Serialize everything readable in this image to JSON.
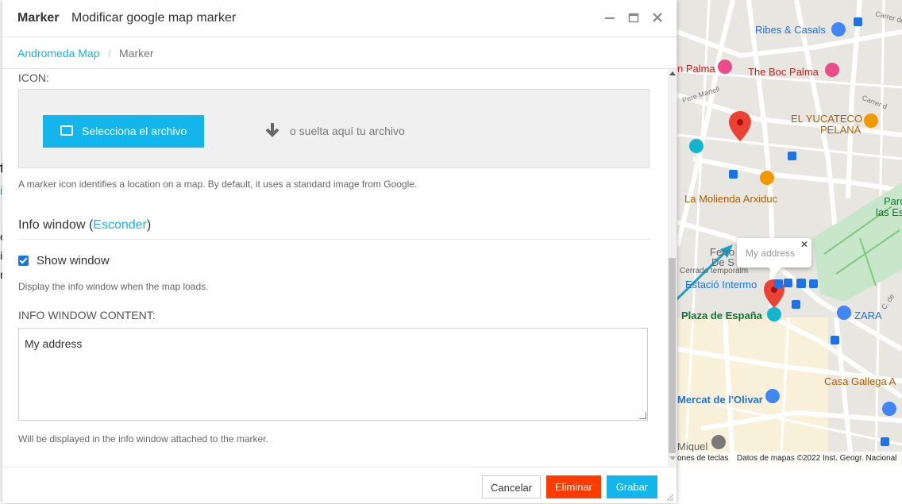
{
  "dialog": {
    "title": "Marker",
    "subtitle": "Modificar google map marker",
    "breadcrumb": {
      "home": "Andromeda Map",
      "separator": "/",
      "current": "Marker"
    },
    "icon_section": {
      "label": "ICON:",
      "select_button": "Selecciona el archivo",
      "drop_text": "o suelta aquí tu archivo",
      "help": "A marker icon identifies a location on a map. By default, it uses a standard image from Google."
    },
    "info_window": {
      "heading": "Info window",
      "toggle_link": "Esconder",
      "show_label": "Show window",
      "show_checked": true,
      "show_help": "Display the info window when the map loads.",
      "content_label": "INFO WINDOW CONTENT:",
      "content_value": "My address",
      "content_help": "Will be displayed in the info window attached to the marker."
    },
    "footer": {
      "cancel": "Cancelar",
      "delete": "Eliminar",
      "save": "Grabar"
    }
  },
  "map": {
    "places": [
      "Ribes & Casals",
      "n Palma",
      "The Boc Palma",
      "EL YUCATECO",
      "PELANÁ",
      "La Molienda Arxiduc",
      "Parc",
      "las Es",
      "Ferro",
      "De S",
      "Cerrado temporalm",
      "Estació Intermo",
      "Plaza de España",
      "ZARA",
      "Casa Gallega A",
      "Mercat de l'Olivar",
      "Miquel"
    ],
    "streets": [
      "Carrer de",
      "Pere Martell",
      "Carrer d",
      "C. de"
    ],
    "info_bubble": "My address",
    "attribution_left": "ones de teclas",
    "attribution_right": "Datos de mapas ©2022 Inst. Geogr. Nacional"
  },
  "colors": {
    "accent": "#13b5ea",
    "danger": "#ff3b00",
    "marker": "#ea4335"
  }
}
